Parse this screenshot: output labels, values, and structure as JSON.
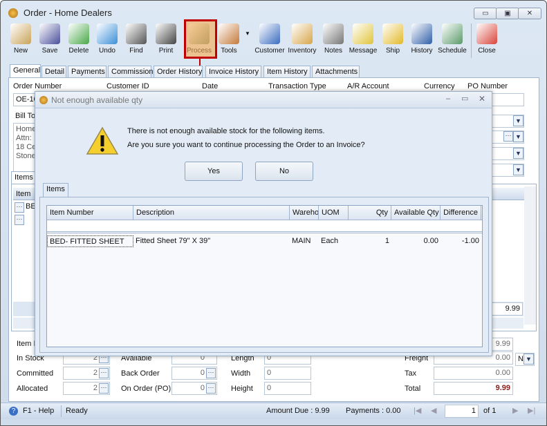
{
  "window": {
    "title": "Order - Home Dealers",
    "controls": [
      "▭",
      "▣",
      "✕"
    ]
  },
  "toolbar": [
    {
      "label": "New",
      "icon": "new-document-icon",
      "color": "#c9a35a"
    },
    {
      "label": "Save",
      "icon": "floppy-disk-icon",
      "color": "#4a4f9a"
    },
    {
      "label": "Delete",
      "icon": "recycle-bin-icon",
      "color": "#4aa84a"
    },
    {
      "label": "Undo",
      "icon": "undo-arrow-icon",
      "color": "#3b8fd9"
    },
    {
      "label": "Find",
      "icon": "binoculars-icon",
      "color": "#555"
    },
    {
      "label": "Print",
      "icon": "printer-icon",
      "color": "#444"
    },
    {
      "label": "Process",
      "icon": "process-gear-icon",
      "color": "#6e8e7a"
    },
    {
      "label": "Tools",
      "icon": "tools-icon",
      "color": "#c57a3a"
    },
    {
      "label": "Customer",
      "icon": "customer-person-icon",
      "color": "#3a6cc0"
    },
    {
      "label": "Inventory",
      "icon": "boxes-icon",
      "color": "#d7a64a"
    },
    {
      "label": "Notes",
      "icon": "notepad-icon",
      "color": "#777"
    },
    {
      "label": "Message",
      "icon": "message-icon",
      "color": "#e0c43a"
    },
    {
      "label": "Ship",
      "icon": "forklift-icon",
      "color": "#e3b92a"
    },
    {
      "label": "History",
      "icon": "history-person-icon",
      "color": "#2f5fa8"
    },
    {
      "label": "Schedule",
      "icon": "schedule-calendar-icon",
      "color": "#5a9a6a"
    },
    {
      "label": "Close",
      "icon": "close-window-icon",
      "color": "#d9443a"
    }
  ],
  "tabs": [
    "General",
    "Detail",
    "Payments",
    "Commission",
    "Order History",
    "Invoice History",
    "Item History",
    "Attachments"
  ],
  "general": {
    "labels": {
      "order_number": "Order Number",
      "customer_id": "Customer ID",
      "date": "Date",
      "transaction_type": "Transaction Type",
      "ar_account": "A/R Account",
      "currency": "Currency",
      "po_number": "PO Number",
      "bill_to": "Bill To"
    },
    "order_number_value": "OE-10",
    "bill_to_lines": [
      "Home",
      "Attn:",
      "18 Ce",
      "Stone"
    ],
    "items_tab": "Items",
    "items_col": "Item",
    "items_row": "BE",
    "grid_total": "9.99",
    "item_label": "Item I",
    "subtotal": "9.99",
    "in_stock": {
      "label": "In Stock",
      "value": "2"
    },
    "committed": {
      "label": "Committed",
      "value": "2"
    },
    "allocated": {
      "label": "Allocated",
      "value": "2"
    },
    "available": {
      "label": "Available",
      "value": "0"
    },
    "back_order": {
      "label": "Back Order",
      "value": "0"
    },
    "on_order": {
      "label": "On Order (PO)",
      "value": "0"
    },
    "length": {
      "label": "Length",
      "value": "0"
    },
    "width": {
      "label": "Width",
      "value": "0"
    },
    "height": {
      "label": "Height",
      "value": "0"
    },
    "freight": {
      "label": "Freight",
      "value": "0.00",
      "option": "N"
    },
    "tax": {
      "label": "Tax",
      "value": "0.00"
    },
    "total": {
      "label": "Total",
      "value": "9.99",
      "color": "#8b1a1a"
    }
  },
  "dialog": {
    "title": "Not enough available qty",
    "message1": "There is not enough available stock for the following items.",
    "message2": "Are you sure you want to continue processing the Order to an Invoice?",
    "yes": "Yes",
    "no": "No",
    "tab": "Items",
    "columns": [
      "Item Number",
      "Description",
      "Wareho",
      "UOM",
      "Qty",
      "Available Qty",
      "Difference"
    ],
    "rows": [
      [
        "BED- FITTED SHEET",
        "Fitted Sheet 79\" X 39\"",
        "MAIN",
        "Each",
        "1",
        "0.00",
        "-1.00"
      ]
    ]
  },
  "status": {
    "help": "F1 - Help",
    "state": "Ready",
    "amount_due": "Amount Due : 9.99",
    "payments": "Payments : 0.00",
    "page": "1",
    "of": "of 1"
  },
  "highlight_color": "#c00000"
}
